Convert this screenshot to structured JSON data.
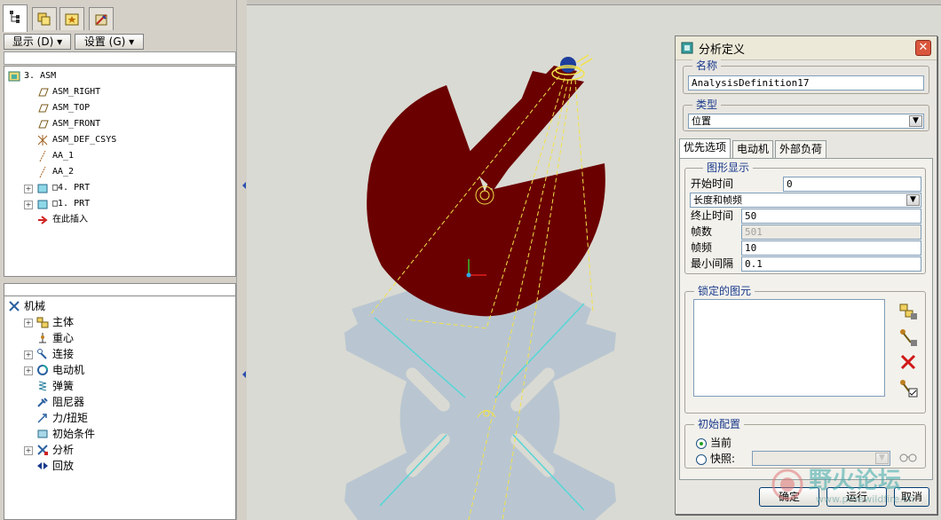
{
  "left_panel": {
    "tabs": [
      {
        "name": "model-tree-tab-icon"
      },
      {
        "name": "layers-tab-icon"
      },
      {
        "name": "favorites-tab-icon"
      },
      {
        "name": "tools-tab-icon"
      }
    ],
    "show_button": "显示 (D) ▾",
    "settings_button": "设置 (G) ▾",
    "model_tree": [
      {
        "label": "3. ASM",
        "icon": "assembly-icon",
        "indent": 0,
        "expandable": false
      },
      {
        "label": "ASM_RIGHT",
        "icon": "datum-plane-icon",
        "indent": 1,
        "expandable": false
      },
      {
        "label": "ASM_TOP",
        "icon": "datum-plane-icon",
        "indent": 1,
        "expandable": false
      },
      {
        "label": "ASM_FRONT",
        "icon": "datum-plane-icon",
        "indent": 1,
        "expandable": false
      },
      {
        "label": "ASM_DEF_CSYS",
        "icon": "csys-icon",
        "indent": 1,
        "expandable": false
      },
      {
        "label": "AA_1",
        "icon": "datum-axis-icon",
        "indent": 1,
        "expandable": false
      },
      {
        "label": "AA_2",
        "icon": "datum-axis-icon",
        "indent": 1,
        "expandable": false
      },
      {
        "label": "□4. PRT",
        "icon": "part-icon",
        "indent": 1,
        "expandable": true
      },
      {
        "label": "□1. PRT",
        "icon": "part-icon",
        "indent": 1,
        "expandable": true
      },
      {
        "label": "在此插入",
        "icon": "insert-here-arrow-icon",
        "indent": 1,
        "expandable": false
      }
    ],
    "mech_tree": [
      {
        "label": "机械",
        "icon": "mechanism-icon",
        "indent": 0,
        "expandable": false
      },
      {
        "label": "主体",
        "icon": "body-icon",
        "indent": 1,
        "expandable": true
      },
      {
        "label": "重心",
        "icon": "center-of-gravity-icon",
        "indent": 1,
        "expandable": false
      },
      {
        "label": "连接",
        "icon": "connection-icon",
        "indent": 1,
        "expandable": true
      },
      {
        "label": "电动机",
        "icon": "motor-icon",
        "indent": 1,
        "expandable": true
      },
      {
        "label": "弹簧",
        "icon": "spring-icon",
        "indent": 1,
        "expandable": false
      },
      {
        "label": "阻尼器",
        "icon": "damper-icon",
        "indent": 1,
        "expandable": false
      },
      {
        "label": "力/扭矩",
        "icon": "force-torque-icon",
        "indent": 1,
        "expandable": false
      },
      {
        "label": "初始条件",
        "icon": "initial-condition-icon",
        "indent": 1,
        "expandable": false
      },
      {
        "label": "分析",
        "icon": "analysis-icon",
        "indent": 1,
        "expandable": true
      },
      {
        "label": "回放",
        "icon": "playback-icon",
        "indent": 1,
        "expandable": false
      }
    ]
  },
  "dialog": {
    "title": "分析定义",
    "name_group": "名称",
    "name_value": "AnalysisDefinition17",
    "type_group": "类型",
    "type_value": "位置",
    "tabs": [
      "优先选项",
      "电动机",
      "外部负荷"
    ],
    "graphics_group": "图形显示",
    "start_time_label": "开始时间",
    "start_time_value": "0",
    "mode_value": "长度和帧频",
    "end_time_label": "终止时间",
    "end_time_value": "50",
    "frames_label": "帧数",
    "frames_value": "501",
    "frame_rate_label": "帧频",
    "frame_rate_value": "10",
    "min_interval_label": "最小间隔",
    "min_interval_value": "0.1",
    "locked_group": "锁定的图元",
    "initial_group": "初始配置",
    "current_label": "当前",
    "snapshot_label": "快照:",
    "ok_button": "确定",
    "run_button": "运行",
    "cancel_button": "取消"
  },
  "watermark": {
    "title": "野火论坛",
    "url": "www.proewildfire.cn"
  },
  "colors": {
    "disc": "#6b0000",
    "geneva": "#b9c6d1",
    "edge": "#55d6d6",
    "trajectory": "#f2e24a",
    "background": "#d9dad3"
  }
}
